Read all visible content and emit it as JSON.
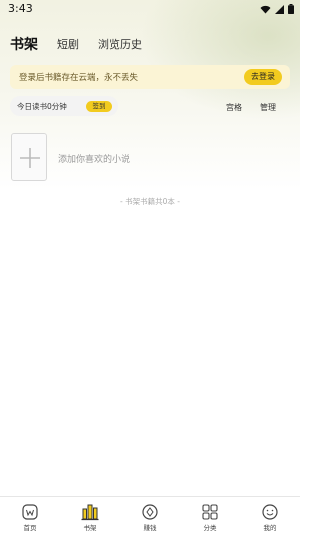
{
  "status_bar": {
    "time": "3:43"
  },
  "header_tabs": [
    {
      "label": "书架",
      "active": true
    },
    {
      "label": "短剧",
      "active": false
    },
    {
      "label": "浏览历史",
      "active": false
    }
  ],
  "login_banner": {
    "text": "登录后书籍存在云端，永不丢失",
    "button": "去登录"
  },
  "reading": {
    "today_text": "今日读书0分钟",
    "sign_button": "签到"
  },
  "shelf_actions": {
    "view_mode": "宫格",
    "manage": "管理"
  },
  "add_book": {
    "label": "添加你喜欢的小说"
  },
  "shelf_count": "- 书架书籍共0本 -",
  "bottom_nav": [
    {
      "label": "首页",
      "icon": "home-w-icon",
      "active": false
    },
    {
      "label": "书架",
      "icon": "bookshelf-icon",
      "active": true
    },
    {
      "label": "赚钱",
      "icon": "coin-icon",
      "active": false
    },
    {
      "label": "分类",
      "icon": "grid-category-icon",
      "active": false
    },
    {
      "label": "我的",
      "icon": "smiley-profile-icon",
      "active": false
    }
  ],
  "colors": {
    "accent": "#f2cb1f",
    "banner_bg": "#fbf4d5"
  }
}
